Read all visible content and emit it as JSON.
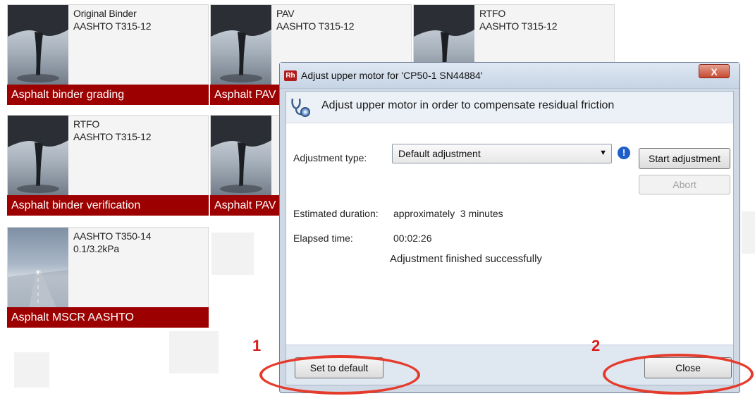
{
  "tiles": [
    {
      "line1": "Original Binder",
      "line2": "AASHTO T315-12",
      "bar": "Asphalt binder grading"
    },
    {
      "line1": "PAV",
      "line2": "AASHTO T315-12",
      "bar": "Asphalt PAV"
    },
    {
      "line1": "RTFO",
      "line2": "AASHTO T315-12",
      "bar": ""
    },
    {
      "line1": "RTFO",
      "line2": "AASHTO T315-12",
      "bar": "Asphalt binder verification"
    },
    {
      "line1": "",
      "line2": "",
      "bar": "Asphalt PAV"
    },
    {
      "line1": "AASHTO T350-14",
      "line2": "0.1/3.2kPa",
      "bar": "Asphalt MSCR AASHTO"
    }
  ],
  "dialog": {
    "app_icon": "Rh",
    "title": "Adjust upper motor for 'CP50-1 SN44884'",
    "close_glyph": "X",
    "header": "Adjust upper motor in order to compensate residual friction",
    "header_icon": "stethoscope-icon",
    "adjustment_type_label": "Adjustment type:",
    "adjustment_type_value": "Default adjustment",
    "info_glyph": "!",
    "start_button": "Start adjustment",
    "abort_button": "Abort",
    "estimated_duration_label": "Estimated duration:",
    "estimated_duration_value": "approximately  3 minutes",
    "elapsed_time_label": "Elapsed time:",
    "elapsed_time_value": "00:02:26",
    "status": "Adjustment finished successfully",
    "set_default_button": "Set to default",
    "close_button": "Close"
  },
  "annotations": {
    "marker1": "1",
    "marker2": "2",
    "color": "#e53b2c"
  }
}
